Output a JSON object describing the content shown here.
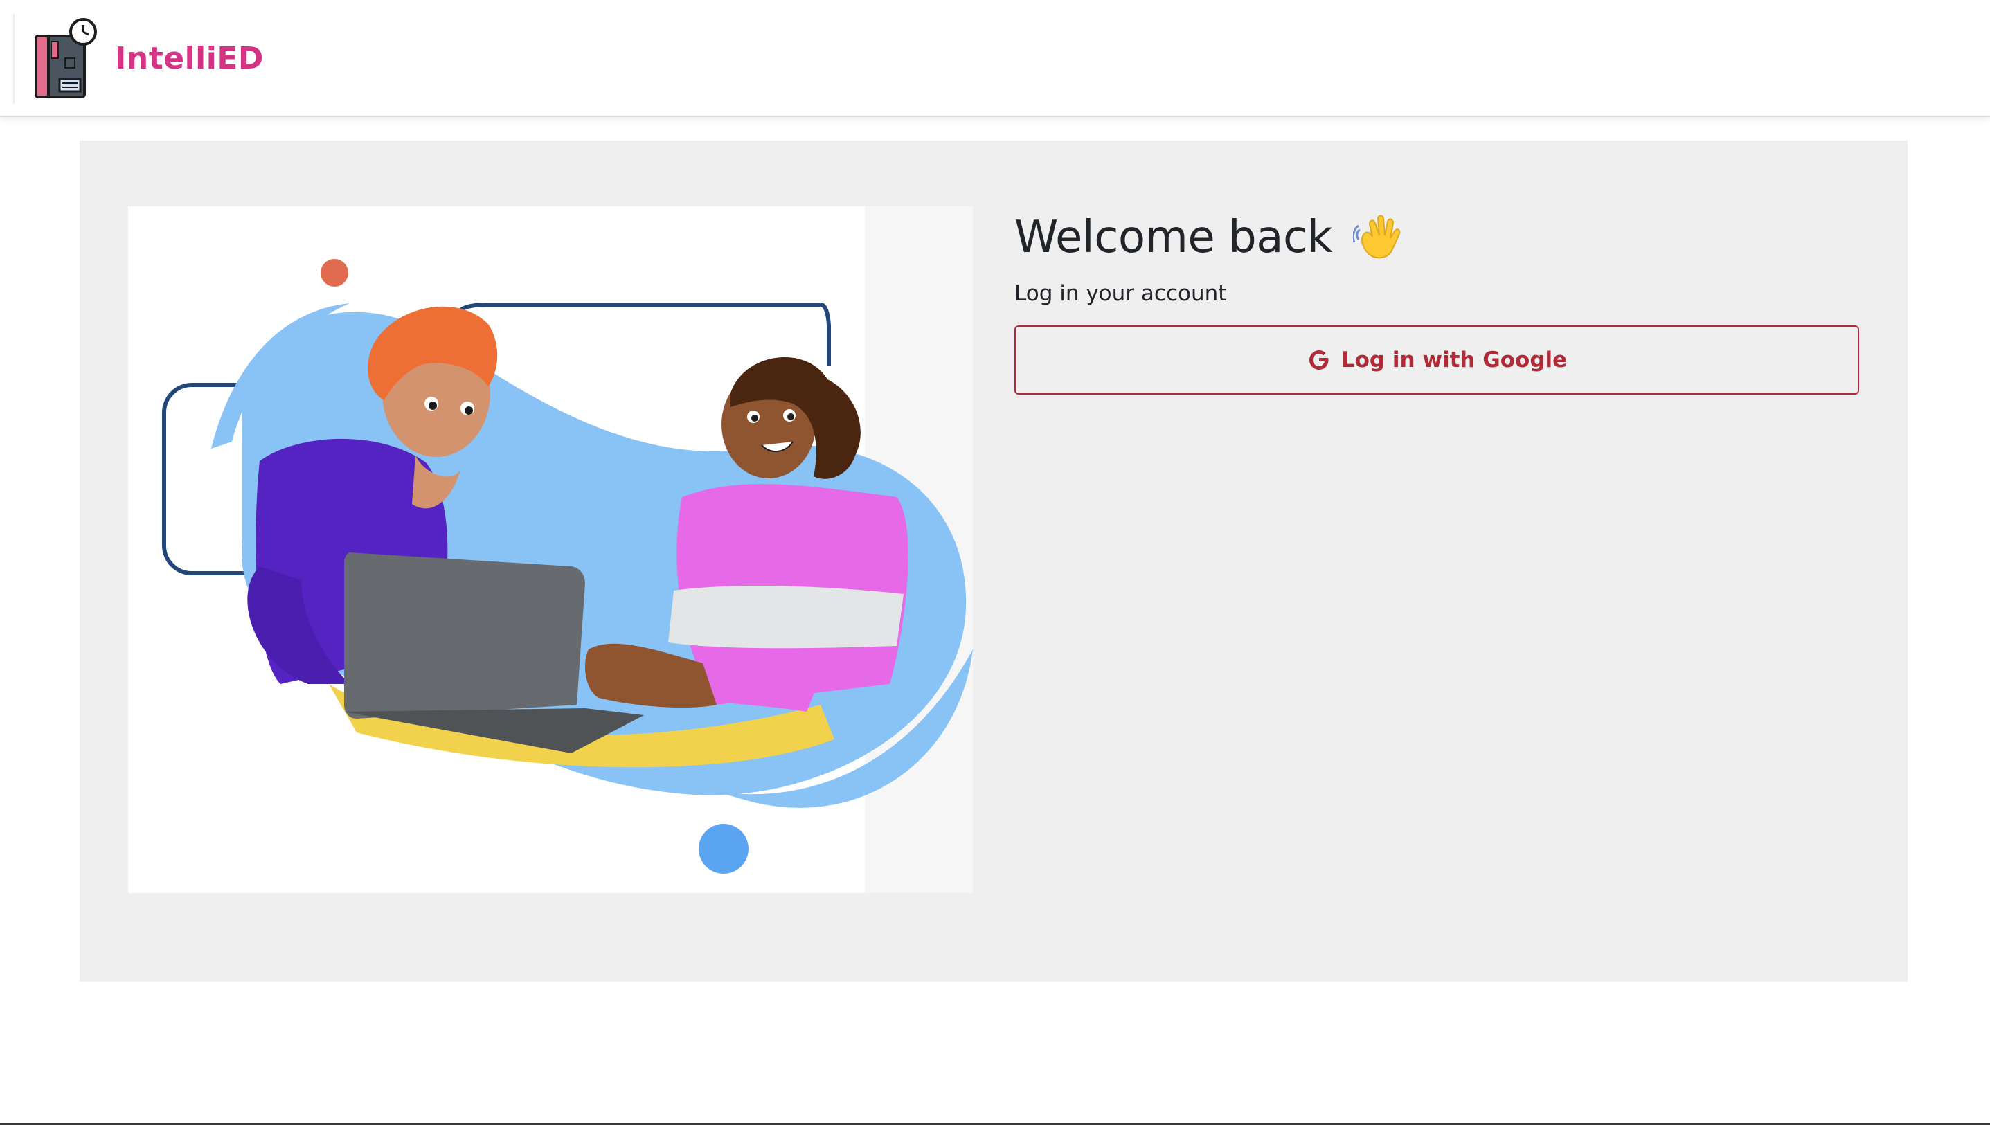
{
  "brand": {
    "name": "IntelliED",
    "logo_icon": "book-clock-logo",
    "color": "#d63384"
  },
  "login": {
    "title": "Welcome back",
    "title_icon": "waving-hand-icon",
    "subtitle": "Log in your account",
    "google_button_label": "Log in with Google",
    "google_icon": "google-g-icon",
    "accent_color": "#b02a37"
  },
  "illustration": {
    "subject": "two-people-at-laptop-illustration"
  },
  "colors": {
    "card_background": "#efefef",
    "page_background": "#ffffff"
  }
}
